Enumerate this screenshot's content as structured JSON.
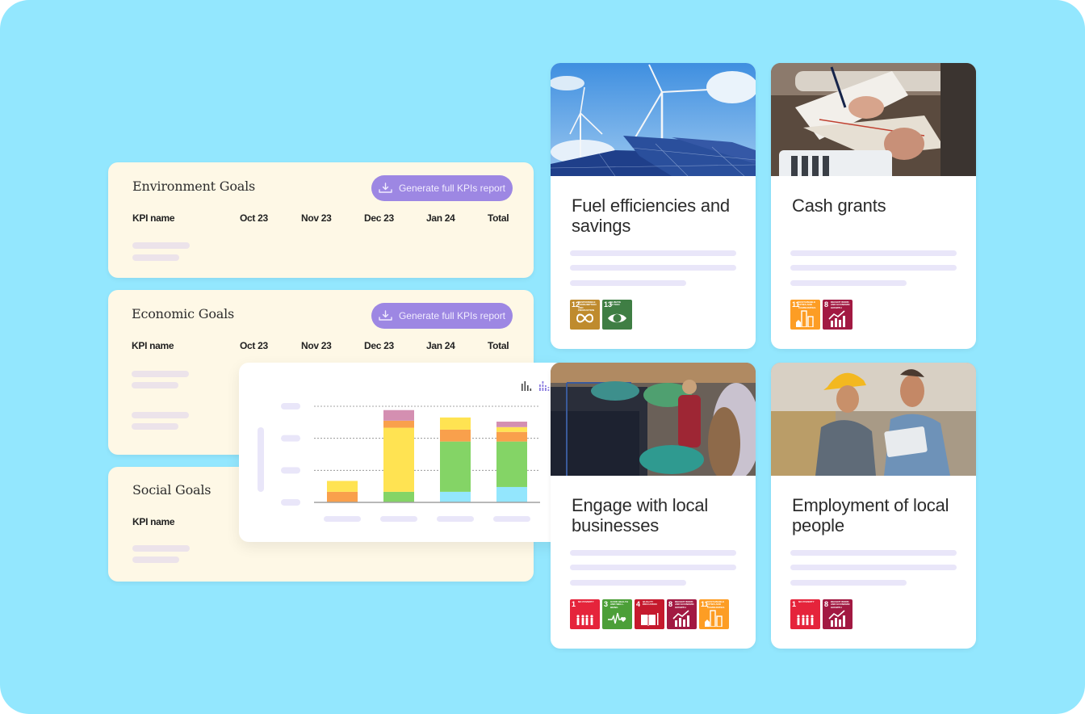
{
  "colors": {
    "background": "#93e7fe",
    "panel": "#fef8e6",
    "button": "#9d87e3",
    "skeleton_panel": "#ece3ea",
    "skeleton_card": "#e9e6f9",
    "series": {
      "blue": "#93e6fd",
      "green": "#84d466",
      "yellow": "#ffe352",
      "orange": "#f9a04c",
      "pink": "#d48fb1"
    }
  },
  "goal_panels": [
    {
      "title": "Environment Goals",
      "button_label": "Generate full KPIs report",
      "button_icon": "download-icon",
      "columns": [
        "KPI name",
        "Oct 23",
        "Nov 23",
        "Dec 23",
        "Jan 24",
        "Total"
      ]
    },
    {
      "title": "Economic Goals",
      "button_label": "Generate full KPIs report",
      "button_icon": "download-icon",
      "columns": [
        "KPI name",
        "Oct 23",
        "Nov 23",
        "Dec 23",
        "Jan 24",
        "Total"
      ]
    },
    {
      "title": "Social Goals",
      "columns": [
        "KPI name"
      ]
    }
  ],
  "chart_toggle": [
    {
      "icon": "bar-chart-icon",
      "active": false
    },
    {
      "icon": "stacked-bar-chart-icon",
      "active": true
    }
  ],
  "chart_data": {
    "type": "bar",
    "stacked": true,
    "title": "",
    "xlabel": "",
    "ylabel": "",
    "categories": [
      "",
      "",
      "",
      ""
    ],
    "ylim": [
      0,
      3
    ],
    "grid": true,
    "series": [
      {
        "name": "blue",
        "color": "#93e6fd",
        "values": [
          0,
          0,
          0.33,
          0.48
        ]
      },
      {
        "name": "green",
        "color": "#84d466",
        "values": [
          0,
          0.33,
          1.57,
          1.42
        ]
      },
      {
        "name": "orange-low",
        "color": "#f9a04c",
        "values": [
          0.33,
          0,
          0,
          0
        ]
      },
      {
        "name": "yellow",
        "color": "#ffe352",
        "values": [
          0.34,
          2.0,
          0,
          0
        ]
      },
      {
        "name": "orange",
        "color": "#f9a04c",
        "values": [
          0,
          0.22,
          0.37,
          0.3
        ]
      },
      {
        "name": "yellow-top",
        "color": "#ffe352",
        "values": [
          0,
          0,
          0.38,
          0.15
        ]
      },
      {
        "name": "pink",
        "color": "#d48fb1",
        "values": [
          0,
          0.33,
          0,
          0.17
        ]
      }
    ]
  },
  "project_cards": [
    {
      "title": "Fuel efficiencies and savings",
      "photo": "wind-turbines-solar-panels-photo",
      "sdgs": [
        {
          "num": "12",
          "label": "Responsible consumption and production",
          "color": "#bf8b2e",
          "icon": "infinity-icon"
        },
        {
          "num": "13",
          "label": "Climate action",
          "color": "#3f7e44",
          "icon": "eye-globe-icon"
        }
      ]
    },
    {
      "title": "Cash grants",
      "photo": "person-writing-on-plans-photo",
      "sdgs": [
        {
          "num": "11",
          "label": "Sustainable cities and communities",
          "color": "#fd9d24",
          "icon": "city-icon"
        },
        {
          "num": "8",
          "label": "Decent work and economic growth",
          "color": "#a21942",
          "icon": "growth-chart-icon"
        }
      ]
    },
    {
      "title": "Engage with local businesses",
      "photo": "clothing-warehouse-workers-photo",
      "sdgs": [
        {
          "num": "1",
          "label": "No poverty",
          "color": "#e5243b",
          "icon": "family-icon"
        },
        {
          "num": "3",
          "label": "Good health and well-being",
          "color": "#4c9f38",
          "icon": "heartbeat-icon"
        },
        {
          "num": "4",
          "label": "Quality education",
          "color": "#c5192d",
          "icon": "book-icon"
        },
        {
          "num": "8",
          "label": "Decent work and economic growth",
          "color": "#a21942",
          "icon": "growth-chart-icon"
        },
        {
          "num": "11",
          "label": "Sustainable cities and communities",
          "color": "#fd9d24",
          "icon": "city-icon"
        }
      ]
    },
    {
      "title": "Employment of local people",
      "photo": "workers-with-tablet-photo",
      "sdgs": [
        {
          "num": "1",
          "label": "No poverty",
          "color": "#e5243b",
          "icon": "family-icon"
        },
        {
          "num": "8",
          "label": "Decent work and economic growth",
          "color": "#a21942",
          "icon": "growth-chart-icon"
        }
      ]
    }
  ]
}
